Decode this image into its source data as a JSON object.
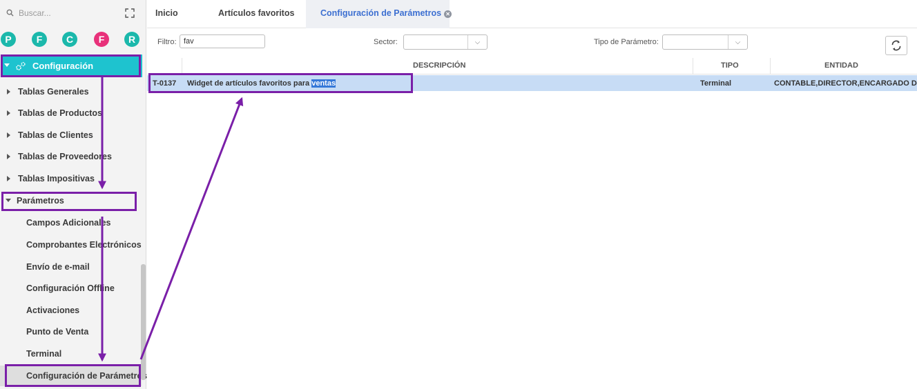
{
  "sidebar": {
    "search_placeholder": "Buscar...",
    "shortcuts": [
      {
        "letter": "P",
        "color": "#1bb8ab"
      },
      {
        "letter": "F",
        "color": "#1bb8ab"
      },
      {
        "letter": "C",
        "color": "#1bb8ab"
      },
      {
        "letter": "F",
        "color": "#e8317a"
      },
      {
        "letter": "R",
        "color": "#1bb8ab"
      }
    ],
    "root": "Configuración",
    "groups": [
      "Tablas Generales",
      "Tablas de Productos",
      "Tablas de Clientes",
      "Tablas de Proveedores",
      "Tablas Impositivas"
    ],
    "open_group": "Parámetros",
    "sub_items": [
      "Campos Adicionales",
      "Comprobantes Electrónicos",
      "Envío de e-mail",
      "Configuración Offline",
      "Activaciones",
      "Punto de Venta",
      "Terminal",
      "Configuración de Parámetros"
    ]
  },
  "tabs": [
    {
      "label": "Inicio",
      "active": false
    },
    {
      "label": "Artículos favoritos",
      "active": false
    },
    {
      "label": "Configuración de Parámetros",
      "active": true
    }
  ],
  "filters": {
    "filtro_label": "Filtro:",
    "filtro_value": "fav",
    "sector_label": "Sector:",
    "sector_value": "",
    "tipo_label": "Tipo de Parámetro:",
    "tipo_value": ""
  },
  "grid": {
    "columns": [
      "DESCRIPCIÓN",
      "TIPO",
      "ENTIDAD"
    ],
    "rows": [
      {
        "code": "T-0137",
        "description_prefix": "Widget de artículos favoritos para ",
        "description_highlight": "ventas",
        "tipo": "Terminal",
        "entidad": "CONTABLE,DIRECTOR,ENCARGADO DEPC"
      }
    ]
  },
  "colors": {
    "accent": "#1ec3cf",
    "annotation": "#7a1fa8",
    "selected_row": "#c7dcf5",
    "active_tab_text": "#3c6fd1"
  },
  "icons": [
    "search-icon",
    "expand-icon",
    "gear-icon",
    "refresh-icon",
    "close-tab-icon",
    "chevron-down-icon"
  ]
}
